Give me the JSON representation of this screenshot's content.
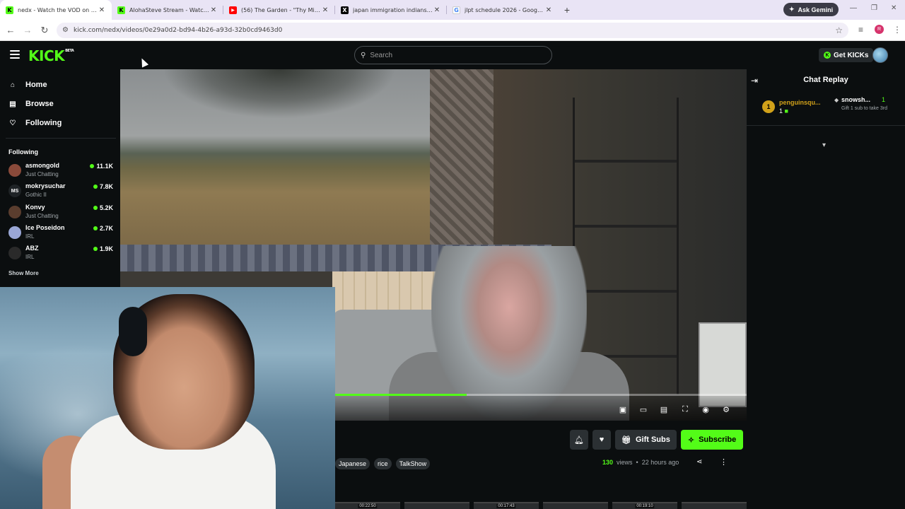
{
  "browser": {
    "tabs": [
      {
        "title": "nedx - Watch the VOD on Kick",
        "favicon": "K",
        "favicon_color": "#53fc18",
        "active": true
      },
      {
        "title": "AlohaSteve Stream - Watch Live",
        "favicon": "K",
        "favicon_color": "#53fc18",
        "active": false
      },
      {
        "title": "(56) The Garden - \"Thy Mission",
        "favicon": "▶",
        "favicon_color": "#ff0000",
        "active": false
      },
      {
        "title": "japan immigration indians - Sea",
        "favicon": "X",
        "favicon_color": "#000000",
        "active": false
      },
      {
        "title": "jlpt schedule 2026 - Google Sea",
        "favicon": "G",
        "favicon_color": "#4285f4",
        "active": false
      }
    ],
    "new_tab_icon": "plus-icon",
    "gemini_label": "Ask Gemini",
    "url": "kick.com/nedx/videos/0e29a0d2-bd94-4b26-a93d-32b0cd9463d0",
    "profile_initial": "R"
  },
  "kick": {
    "logo": "KICK",
    "logo_badge": "BETA",
    "search_placeholder": "Search",
    "get_kicks_label": "Get KICKs",
    "accent": "#53fc18"
  },
  "sidebar": {
    "nav": [
      {
        "label": "Home",
        "icon": "home-icon"
      },
      {
        "label": "Browse",
        "icon": "browse-icon"
      },
      {
        "label": "Following",
        "icon": "heart-icon"
      }
    ],
    "following_heading": "Following",
    "channels": [
      {
        "name": "asmongold",
        "category": "Just Chatting",
        "viewers": "11.1K",
        "avatar_color": "#8a4a3a",
        "initials": ""
      },
      {
        "name": "mokrysuchar",
        "category": "Gothic II",
        "viewers": "7.8K",
        "avatar_color": "#1f2326",
        "initials": "MS"
      },
      {
        "name": "Konvy",
        "category": "Just Chatting",
        "viewers": "5.2K",
        "avatar_color": "#5a3d2e",
        "initials": ""
      },
      {
        "name": "Ice Poseidon",
        "category": "IRL",
        "viewers": "2.7K",
        "avatar_color": "#9aa7d6",
        "initials": ""
      },
      {
        "name": "ABZ",
        "category": "IRL",
        "viewers": "1.9K",
        "avatar_color": "#2a2a2a",
        "initials": ""
      }
    ],
    "show_more": "Show More"
  },
  "player": {
    "progress": 0.32,
    "controls": [
      "miniplayer-icon",
      "theater-icon",
      "captions-icon",
      "fullscreen-icon",
      "autoplay-icon",
      "settings-icon"
    ]
  },
  "actions": {
    "gift_label": "Gift Subs",
    "subscribe_label": "Subscribe"
  },
  "video_info": {
    "tags": [
      "Japanese",
      "rice",
      "TalkShow"
    ],
    "views": "130",
    "views_label": "views",
    "separator": "•",
    "age": "22 hours ago"
  },
  "thumbnails": [
    "00:22:50",
    "",
    "00:17:43",
    "",
    "00:19:10",
    ""
  ],
  "chat": {
    "title": "Chat Replay",
    "top_gifter": {
      "rank": "1",
      "name": "penguinsqu...",
      "count": "1"
    },
    "second_gifter": {
      "name": "snowsh...",
      "count": "1",
      "note": "Gift 1 sub to take 3rd"
    }
  }
}
